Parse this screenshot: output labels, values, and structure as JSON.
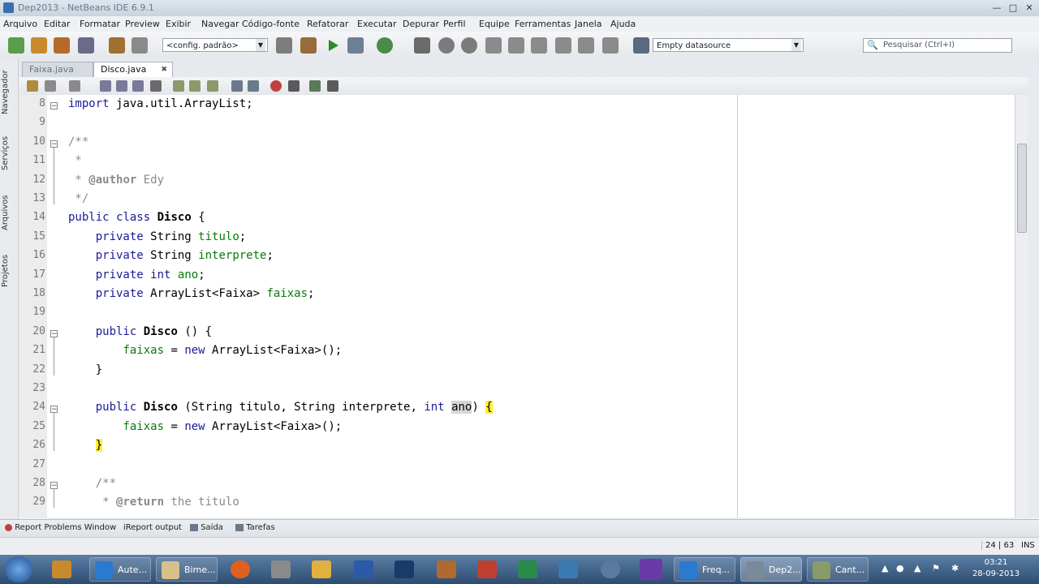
{
  "window": {
    "title": "Dep2013 - NetBeans IDE 6.9.1"
  },
  "menu": [
    "Arquivo",
    "Editar",
    "Formatar",
    "Preview",
    "Exibir",
    "Navegar",
    "Código-fonte",
    "Refatorar",
    "Executar",
    "Depurar",
    "Perfil",
    "Equipe",
    "Ferramentas",
    "Janela",
    "Ajuda"
  ],
  "toolbar": {
    "config_combo": "<config. padrão>",
    "datasource_combo": "Empty datasource",
    "search_placeholder": "Pesquisar (Ctrl+I)"
  },
  "side_tabs": [
    "Navegador",
    "Serviços",
    "Arquivos",
    "Projetos"
  ],
  "editor_tabs": [
    {
      "label": "Faixa.java",
      "active": false
    },
    {
      "label": "Disco.java",
      "active": true
    }
  ],
  "line_numbers": [
    "8",
    "9",
    "10",
    "11",
    "12",
    "13",
    "14",
    "15",
    "16",
    "17",
    "18",
    "19",
    "20",
    "21",
    "22",
    "23",
    "24",
    "25",
    "26",
    "27",
    "28",
    "29"
  ],
  "code": [
    {
      "t": "import java.util.ArrayList;"
    },
    {
      "t": ""
    },
    {
      "t": "/**",
      "c": "cm"
    },
    {
      "t": " *",
      "c": "cm"
    },
    {
      "t": " * @author Edy",
      "c": "cm"
    },
    {
      "t": " */",
      "c": "cm"
    },
    {
      "t": "public class Disco {"
    },
    {
      "t": "    private String titulo;"
    },
    {
      "t": "    private String interprete;"
    },
    {
      "t": "    private int ano;"
    },
    {
      "t": "    private ArrayList<Faixa> faixas;"
    },
    {
      "t": ""
    },
    {
      "t": "    public Disco () {"
    },
    {
      "t": "        faixas = new ArrayList<Faixa>();"
    },
    {
      "t": "    }"
    },
    {
      "t": ""
    },
    {
      "t": "    public Disco (String titulo, String interprete, int ano) {"
    },
    {
      "t": "        faixas = new ArrayList<Faixa>();"
    },
    {
      "t": "    }"
    },
    {
      "t": ""
    },
    {
      "t": "    /**",
      "c": "cm"
    },
    {
      "t": "     * @return the titulo",
      "c": "cm"
    }
  ],
  "bottom_tabs": [
    "Report Problems Window",
    "iReport output",
    "Saída",
    "Tarefas"
  ],
  "status": {
    "position": "24 | 63",
    "mode": "INS"
  },
  "taskbar": {
    "items": [
      "Aute...",
      "Bime...",
      "Freq...",
      "Dep2...",
      "Cant..."
    ],
    "time": "03:21",
    "date": "28-09-2013"
  }
}
